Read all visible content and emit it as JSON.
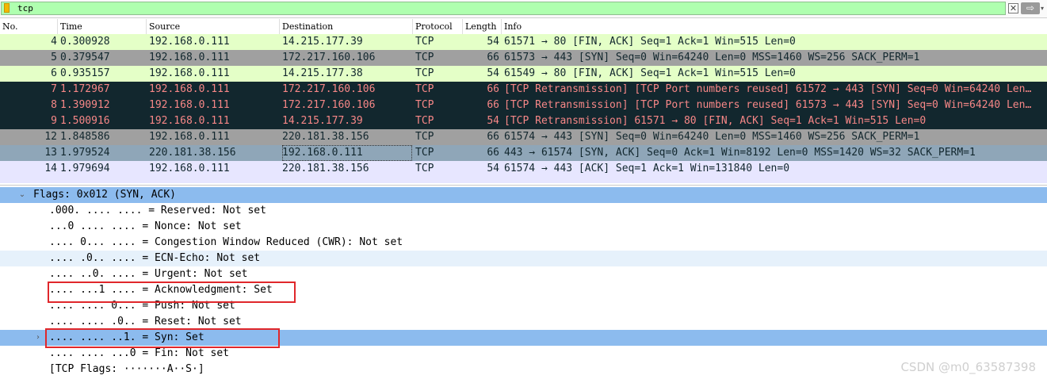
{
  "filter": {
    "value": "tcp",
    "clear_glyph": "✕",
    "apply_glyph": "⇨",
    "dropdown_glyph": "▾"
  },
  "columns": [
    "No.",
    "Time",
    "Source",
    "Destination",
    "Protocol",
    "Length",
    "Info"
  ],
  "packets": [
    {
      "no": "4",
      "time": "0.300928",
      "src": "192.168.0.111",
      "dst": "14.215.177.39",
      "proto": "TCP",
      "len": "54",
      "info": "61571 → 80 [FIN, ACK] Seq=1 Ack=1 Win=515 Len=0",
      "style": "light"
    },
    {
      "no": "5",
      "time": "0.379547",
      "src": "192.168.0.111",
      "dst": "172.217.160.106",
      "proto": "TCP",
      "len": "66",
      "info": "61573 → 443 [SYN] Seq=0 Win=64240 Len=0 MSS=1460 WS=256 SACK_PERM=1",
      "style": "gray"
    },
    {
      "no": "6",
      "time": "0.935157",
      "src": "192.168.0.111",
      "dst": "14.215.177.38",
      "proto": "TCP",
      "len": "54",
      "info": "61549 → 80 [FIN, ACK] Seq=1 Ack=1 Win=515 Len=0",
      "style": "light"
    },
    {
      "no": "7",
      "time": "1.172967",
      "src": "192.168.0.111",
      "dst": "172.217.160.106",
      "proto": "TCP",
      "len": "66",
      "info": "[TCP Retransmission] [TCP Port numbers reused] 61572 → 443 [SYN] Seq=0 Win=64240 Len…",
      "style": "dark"
    },
    {
      "no": "8",
      "time": "1.390912",
      "src": "192.168.0.111",
      "dst": "172.217.160.106",
      "proto": "TCP",
      "len": "66",
      "info": "[TCP Retransmission] [TCP Port numbers reused] 61573 → 443 [SYN] Seq=0 Win=64240 Len…",
      "style": "dark"
    },
    {
      "no": "9",
      "time": "1.500916",
      "src": "192.168.0.111",
      "dst": "14.215.177.39",
      "proto": "TCP",
      "len": "54",
      "info": "[TCP Retransmission] 61571 → 80 [FIN, ACK] Seq=1 Ack=1 Win=515 Len=0",
      "style": "dark"
    },
    {
      "no": "12",
      "time": "1.848586",
      "src": "192.168.0.111",
      "dst": "220.181.38.156",
      "proto": "TCP",
      "len": "66",
      "info": "61574 → 443 [SYN] Seq=0 Win=64240 Len=0 MSS=1460 WS=256 SACK_PERM=1",
      "style": "gray"
    },
    {
      "no": "13",
      "time": "1.979524",
      "src": "220.181.38.156",
      "dst": "192.168.0.111",
      "proto": "TCP",
      "len": "66",
      "info": "443 → 61574 [SYN, ACK] Seq=0 Ack=1 Win=8192 Len=0 MSS=1420 WS=32 SACK_PERM=1",
      "style": "sel13"
    },
    {
      "no": "14",
      "time": "1.979694",
      "src": "192.168.0.111",
      "dst": "220.181.38.156",
      "proto": "TCP",
      "len": "54",
      "info": "61574 → 443 [ACK] Seq=1 Ack=1 Win=131840 Len=0",
      "style": "lav"
    }
  ],
  "details": {
    "flags_header": "Flags: 0x012 (SYN, ACK)",
    "collapse_glyph": "⌄",
    "expand_glyph": "›",
    "lines": [
      ".000. .... .... = Reserved: Not set",
      "...0 .... .... = Nonce: Not set",
      ".... 0... .... = Congestion Window Reduced (CWR): Not set",
      ".... .0.. .... = ECN-Echo: Not set",
      ".... ..0. .... = Urgent: Not set",
      ".... ...1 .... = Acknowledgment: Set",
      ".... .... 0... = Push: Not set",
      ".... .... .0.. = Reset: Not set",
      ".... .... ..1. = Syn: Set",
      ".... .... ...0 = Fin: Not set",
      "[TCP Flags: ·······A··S·]"
    ]
  },
  "watermark": "CSDN @m0_63587398"
}
